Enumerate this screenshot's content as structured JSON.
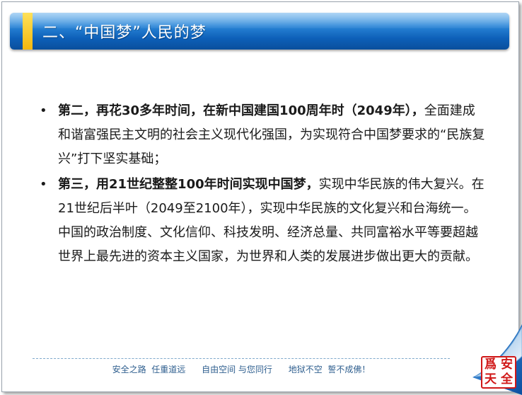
{
  "title": "二、“中国梦”人民的梦",
  "bullets": [
    {
      "marker": "•",
      "bold": "第二，再花30多年时间，在新中国建国100周年时（2049年），",
      "rest": "全面建成和谐富强民主文明的社会主义现代化强国，为实现符合中国梦要求的“民族复兴”打下坚实基础；"
    },
    {
      "marker": "•",
      "bold": "第三，用21世纪整整100年时间实现中国梦，",
      "rest": "实现中华民族的伟大复兴。在21世纪后半叶（2049至2100年），实现中华民族的文化复兴和台海统一。中国的政治制度、文化信仰、科技发明、经济总量、共同富裕水平等要超越世界上最先进的资本主义国家，为世界和人类的发展进步做出更大的贡献。"
    }
  ],
  "footer": "安全之路  任重道远      自由空间 与您同行      地狱不空  誓不成佛！",
  "seal": {
    "chars": [
      "安",
      "爲",
      "全",
      "天"
    ]
  },
  "colors": {
    "title_bar": "#0d5fb8",
    "title_accent": "#f3b70f",
    "footer_text": "#2f5f8f",
    "seal_red": "#d01818",
    "curl_blue": "#1a73d0"
  }
}
